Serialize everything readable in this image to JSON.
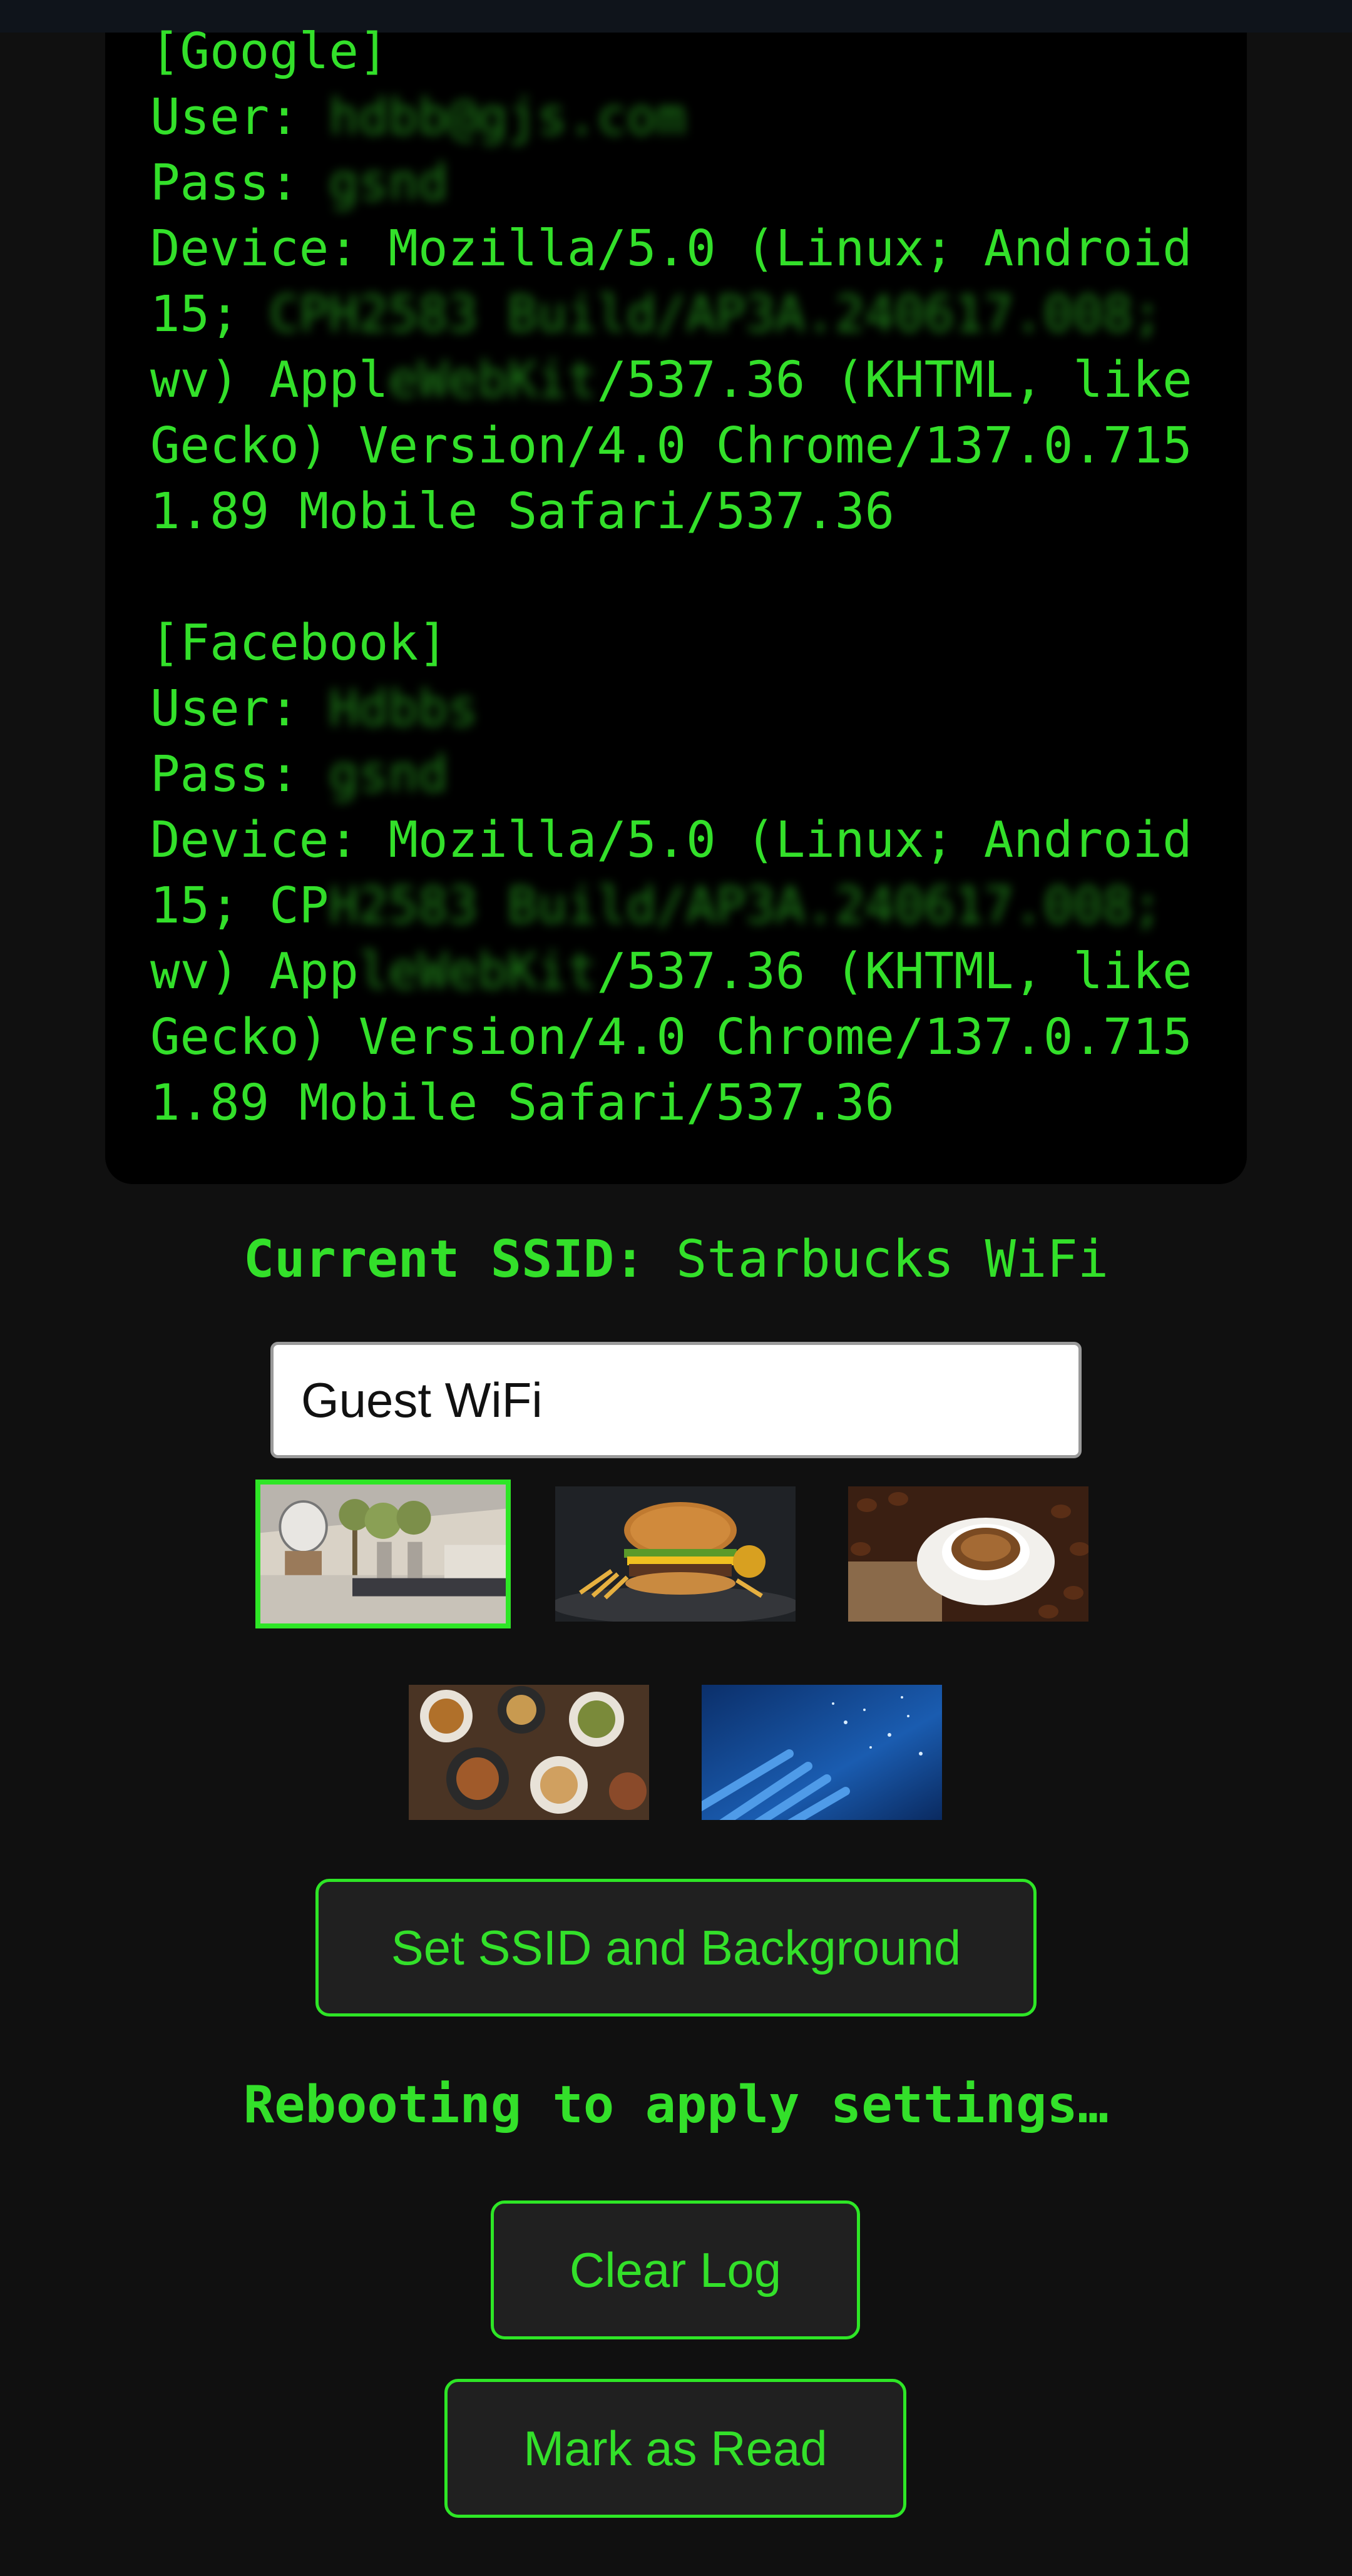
{
  "log": {
    "google_header": "[Google]",
    "google_user_label": "User: ",
    "google_user_value": "hdbb@gjs.com",
    "google_pass_label": "Pass: ",
    "google_pass_value": "gsnd",
    "google_device_1": "Device: Mozilla/5.0 (Linux; Android",
    "google_device_2a": "15; ",
    "google_device_2b": "CPH2583 Build/AP3A.240617.008;",
    "google_device_3a": "wv) Appl",
    "google_device_3b": "eWebKit",
    "google_device_3c": "/537.36 (KHTML, like",
    "google_device_4": "Gecko) Version/4.0 Chrome/137.0.715",
    "google_device_5": "1.89 Mobile Safari/537.36",
    "facebook_header": "[Facebook]",
    "facebook_user_label": "User: ",
    "facebook_user_value": "Hdbbs",
    "facebook_pass_label": "Pass: ",
    "facebook_pass_value": "gsnd",
    "facebook_device_1": "Device: Mozilla/5.0 (Linux; Android",
    "facebook_device_2a": "15; CP",
    "facebook_device_2b": "H2583 Build/AP3A.240617.008;",
    "facebook_device_3a": "wv) App",
    "facebook_device_3b": "leWebKit",
    "facebook_device_3c": "/537.36 (KHTML, like",
    "facebook_device_4": "Gecko) Version/4.0 Chrome/137.0.715",
    "facebook_device_5": "1.89 Mobile Safari/537.36"
  },
  "ssid": {
    "label": "Current SSID:",
    "value": "Starbucks WiFi",
    "input_value": "Guest WiFi"
  },
  "backgrounds": [
    {
      "name": "lounge",
      "selected": true
    },
    {
      "name": "burger",
      "selected": false
    },
    {
      "name": "coffee",
      "selected": false
    },
    {
      "name": "dinner-table",
      "selected": false
    },
    {
      "name": "network-cables",
      "selected": false
    }
  ],
  "buttons": {
    "set_ssid": "Set SSID and Background",
    "clear_log": "Clear Log",
    "mark_read": "Mark as Read"
  },
  "status": {
    "text": "Rebooting to apply settings…"
  },
  "colors": {
    "accent": "#33e02a",
    "background": "#101010",
    "panel": "#000000"
  }
}
